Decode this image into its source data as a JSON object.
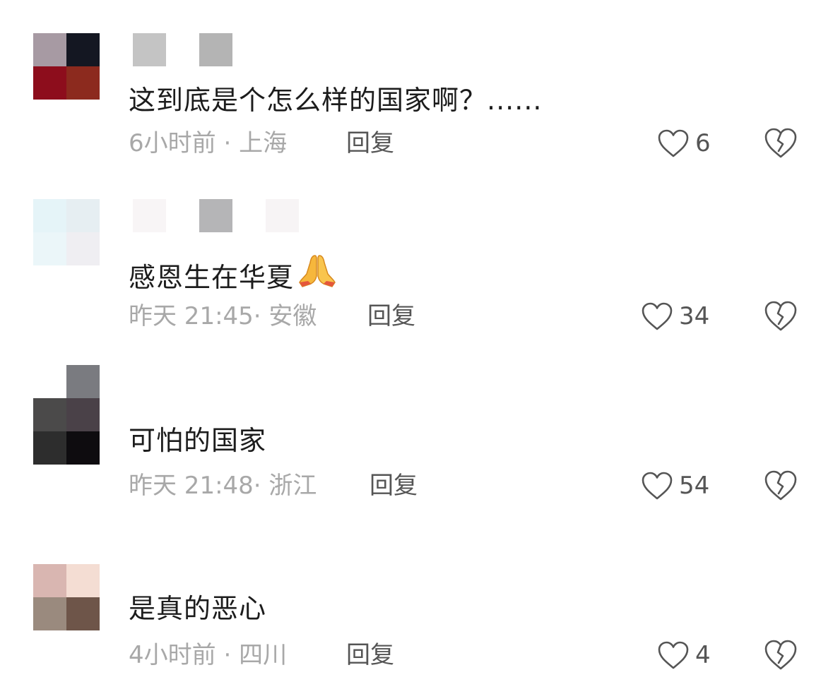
{
  "comments": [
    {
      "text": "这到底是个怎么样的国家啊？......",
      "time": "6小时前",
      "location": "上海",
      "reply_label": "回复",
      "likes": "6",
      "avatar_colors": [
        "#a79aa3",
        "#141722",
        "#8d0d1c",
        "#8c2a1e"
      ],
      "name_colors": [
        "#c4c4c4",
        "#b4b4b4"
      ],
      "name_icon": "pixelated-username"
    },
    {
      "text": "感恩生在华夏",
      "emoji": "folded-hands-emoji",
      "time": "昨天 21:45",
      "location": "安徽",
      "reply_label": "回复",
      "likes": "34",
      "avatar_colors": [
        "#e5f4f8",
        "#e6eef2",
        "#ebf6f9",
        "#efeef2"
      ],
      "name_colors": [
        "#f8f5f6",
        "#b5b5b7",
        "#f7f4f5"
      ],
      "name_icon": "pixelated-username"
    },
    {
      "text": "可怕的国家",
      "time": "昨天 21:48",
      "location": "浙江",
      "reply_label": "回复",
      "likes": "54",
      "avatar_colors": [
        "#ffffff",
        "#7a7b80",
        "#4b4a4a",
        "#4a4148",
        "#2d2d2d",
        "#0e0c0f"
      ],
      "name_colors": [],
      "name_icon": "pixelated-username"
    },
    {
      "text": "是真的恶心",
      "time": "4小时前",
      "location": "四川",
      "reply_label": "回复",
      "likes": "4",
      "avatar_colors": [
        "#d9b6b1",
        "#f4ddd3",
        "#9a8a7e",
        "#6e5549"
      ],
      "name_colors": [],
      "name_icon": "pixelated-username"
    }
  ],
  "icons": {
    "like": "heart-outline-icon",
    "dislike": "broken-heart-icon"
  },
  "colors": {
    "text": "#1c1c1c",
    "meta": "#a8a8a8",
    "action": "#555555"
  }
}
